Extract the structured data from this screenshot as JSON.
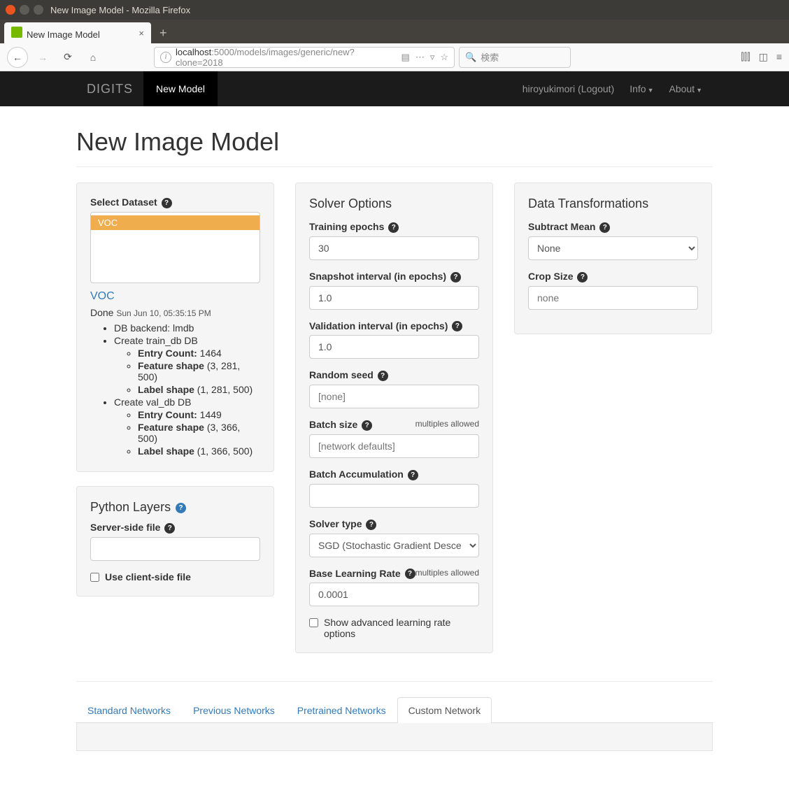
{
  "window": {
    "title": "New Image Model - Mozilla Firefox"
  },
  "browser": {
    "tab_title": "New Image Model",
    "url_host": "localhost",
    "url_path": ":5000/models/images/generic/new?clone=2018",
    "search_placeholder": "検索"
  },
  "nav": {
    "brand": "DIGITS",
    "active": "New Model",
    "user": "hiroyukimori (Logout)",
    "info": "Info",
    "about": "About"
  },
  "page": {
    "title": "New Image Model"
  },
  "dataset": {
    "label": "Select Dataset",
    "items": [
      "VOC"
    ],
    "selected_link": "VOC",
    "status": "Done",
    "status_time": "Sun Jun 10, 05:35:15 PM",
    "db_backend": "DB backend: lmdb",
    "train_db": "Create train_db DB",
    "train_entry_label": "Entry Count:",
    "train_entry_value": " 1464",
    "train_feat_label": "Feature shape",
    "train_feat_value": " (3, 281, 500)",
    "train_label_label": "Label shape",
    "train_label_value": " (1, 281, 500)",
    "val_db": "Create val_db DB",
    "val_entry_label": "Entry Count:",
    "val_entry_value": " 1449",
    "val_feat_label": "Feature shape",
    "val_feat_value": " (3, 366, 500)",
    "val_label_label": "Label shape",
    "val_label_value": " (1, 366, 500)"
  },
  "python": {
    "title": "Python Layers",
    "server_file": "Server-side file",
    "client_cb": "Use client-side file"
  },
  "solver": {
    "title": "Solver Options",
    "epochs_label": "Training epochs",
    "epochs_value": "30",
    "snapshot_label": "Snapshot interval (in epochs)",
    "snapshot_value": "1.0",
    "validation_label": "Validation interval (in epochs)",
    "validation_value": "1.0",
    "seed_label": "Random seed",
    "seed_placeholder": "[none]",
    "batch_label": "Batch size",
    "batch_placeholder": "[network defaults]",
    "multiples": "multiples allowed",
    "accum_label": "Batch Accumulation",
    "type_label": "Solver type",
    "type_value": "SGD (Stochastic Gradient Descent)",
    "lr_label": "Base Learning Rate",
    "lr_value": "0.0001",
    "adv_cb": "Show advanced learning rate options"
  },
  "transforms": {
    "title": "Data Transformations",
    "mean_label": "Subtract Mean",
    "mean_value": "None",
    "crop_label": "Crop Size",
    "crop_placeholder": "none"
  },
  "tabs": {
    "standard": "Standard Networks",
    "previous": "Previous Networks",
    "pretrained": "Pretrained Networks",
    "custom": "Custom Network"
  }
}
